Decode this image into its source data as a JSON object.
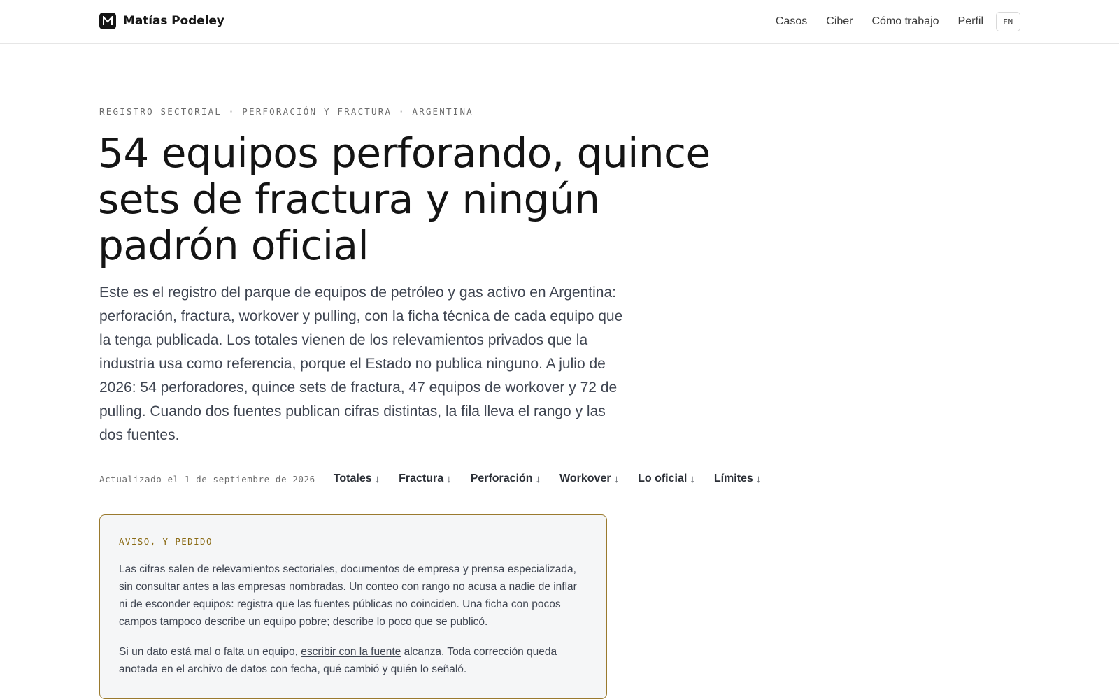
{
  "header": {
    "brand_name": "Matías Podeley",
    "brand_logo_icon": "m-logo-icon",
    "nav": [
      "Casos",
      "Ciber",
      "Cómo trabajo",
      "Perfil"
    ],
    "lang_label": "EN"
  },
  "hero": {
    "eyebrow": "REGISTRO SECTORIAL · PERFORACIÓN Y FRACTURA · ARGENTINA",
    "title": "54 equipos perforando, quince sets de fractura y ningún padrón oficial",
    "lede": "Este es el registro del parque de equipos de petróleo y gas activo en Argentina: perforación, fractura, workover y pulling, con la ficha técnica de cada equipo que la tenga publicada. Los totales vienen de los relevamientos privados que la industria usa como referencia, porque el Estado no publica ninguno. A julio de 2026: 54 perforadores, quince sets de fractura, 47 equipos de workover y 72 de pulling. Cuando dos fuentes publican cifras distintas, la fila lleva el rango y las dos fuentes."
  },
  "meta": {
    "updated": "Actualizado el 1 de septiembre de 2026",
    "jump_links": [
      "Totales",
      "Fractura",
      "Perforación",
      "Workover",
      "Lo oficial",
      "Límites"
    ],
    "arrow_glyph": "↓"
  },
  "notice": {
    "label": "AVISO, Y PEDIDO",
    "p1": "Las cifras salen de relevamientos sectoriales, documentos de empresa y prensa especializada, sin consultar antes a las empresas nombradas. Un conteo con rango no acusa a nadie de inflar ni de esconder equipos: registra que las fuentes públicas no coinciden. Una ficha con pocos campos tampoco describe un equipo pobre; describe lo poco que se publicó.",
    "p2_before": "Si un dato está mal o falta un equipo, ",
    "p2_link": "escribir con la fuente",
    "p2_after": " alcanza. Toda corrección queda anotada en el archivo de datos con fecha, qué cambió y quién lo señaló."
  },
  "colors": {
    "notice_border": "#9a7a2e",
    "notice_label": "#8a6a14",
    "notice_bg": "#f5f6f7",
    "body_text": "#3f4551"
  }
}
